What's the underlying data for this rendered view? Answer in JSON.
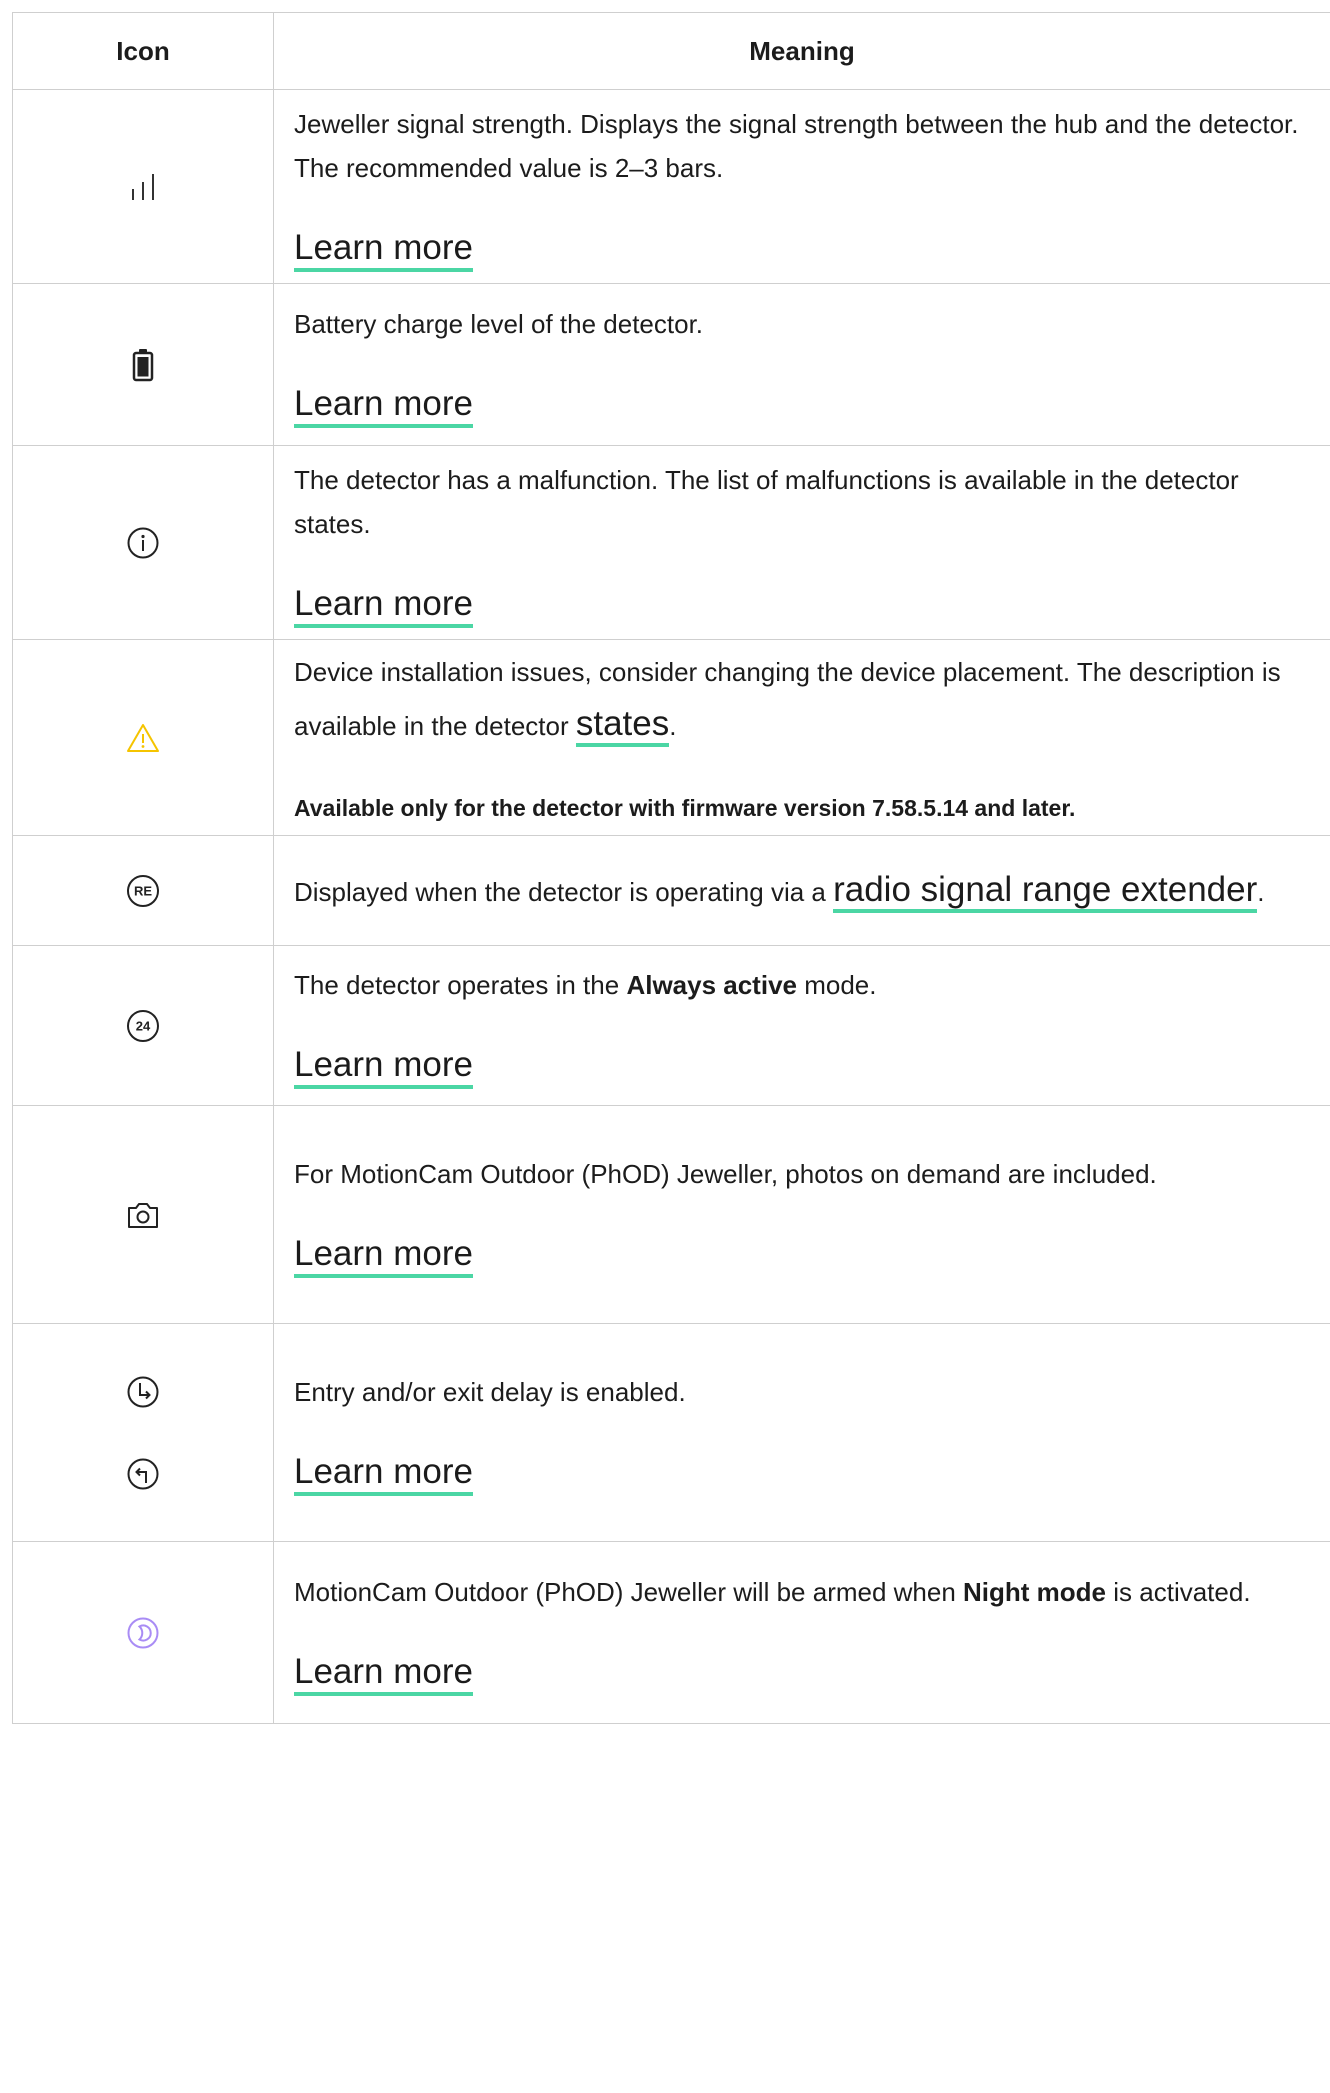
{
  "header": {
    "col_icon": "Icon",
    "col_meaning": "Meaning"
  },
  "rows": [
    {
      "icon": "signal-strength-icon",
      "text": "Jeweller signal strength. Displays the signal strength between the hub and the detector. The recommended value is 2–3 bars.",
      "link": "Learn more"
    },
    {
      "icon": "battery-icon",
      "text": "Battery charge level of the detector.",
      "link": "Learn more"
    },
    {
      "icon": "info-circle-icon",
      "text": "The detector has a malfunction. The list of malfunctions is available in the detector states.",
      "link": "Learn more"
    },
    {
      "icon": "warning-triangle-icon",
      "text_before": "Device installation issues, consider changing the device placement. The description is available in the detector ",
      "inline_link": "states",
      "text_after": ".",
      "note": "Available only for the detector with firmware version 7.58.5.14 and later."
    },
    {
      "icon": "re-circle-icon",
      "text_before": "Displayed when the detector is operating via a ",
      "inline_link": "radio signal range extender",
      "text_after": "."
    },
    {
      "icon": "24-circle-icon",
      "text_before": "The detector operates in the ",
      "bold": "Always active",
      "text_after": " mode.",
      "link": "Learn more"
    },
    {
      "icon": "camera-icon",
      "text": "For MotionCam Outdoor (PhOD) Jeweller, photos on demand are included.",
      "link": "Learn more"
    },
    {
      "icon": "entry-exit-delay-icons",
      "text": "Entry and/or exit delay is enabled.",
      "link": "Learn more"
    },
    {
      "icon": "night-mode-icon",
      "text_before": "MotionCam Outdoor (PhOD) Jeweller will be armed when ",
      "bold": "Night mode",
      "text_after": " is activated.",
      "link": "Learn more"
    }
  ],
  "colors": {
    "link_underline": "#4bd6a4",
    "warning": "#f5c400",
    "night_mode": "#a98cf5",
    "border": "#cfcfcf"
  }
}
